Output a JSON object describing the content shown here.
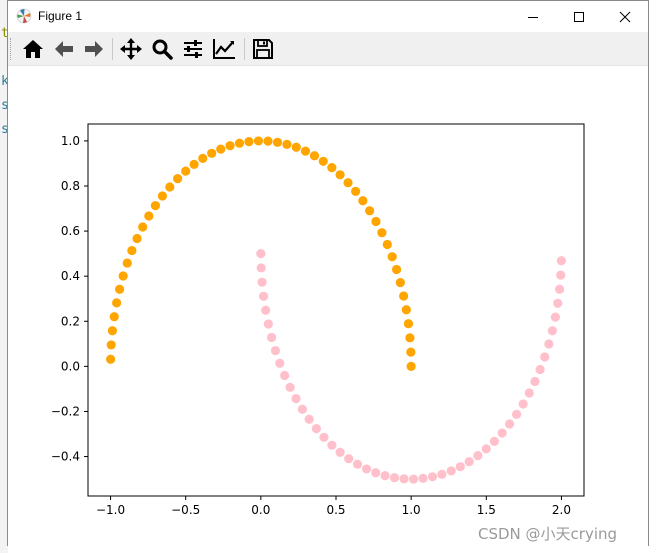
{
  "background": {
    "chars": [
      {
        "text": "t",
        "color": "#8a8a00",
        "top": 26
      },
      {
        "text": "k",
        "color": "#2e7d9a",
        "top": 74
      },
      {
        "text": "s",
        "color": "#2e7d9a",
        "top": 98
      },
      {
        "text": "s",
        "color": "#2e7d9a",
        "top": 122
      }
    ]
  },
  "window": {
    "title": "Figure 1",
    "controls": {
      "minimize": "minimize",
      "maximize": "maximize",
      "close": "close"
    }
  },
  "toolbar": {
    "buttons": [
      {
        "icon": "home-icon"
      },
      {
        "icon": "back-arrow-icon"
      },
      {
        "icon": "forward-arrow-icon"
      },
      {
        "icon": "pan-icon"
      },
      {
        "icon": "zoom-icon"
      },
      {
        "icon": "subplots-icon"
      },
      {
        "icon": "edit-axis-icon"
      },
      {
        "icon": "save-icon"
      }
    ]
  },
  "chart_data": {
    "type": "scatter",
    "title": "",
    "xlabel": "",
    "ylabel": "",
    "xlim": [
      -1.15,
      2.15
    ],
    "ylim": [
      -0.575,
      1.075
    ],
    "xticks": [
      -1.0,
      -0.5,
      0.0,
      0.5,
      1.0,
      1.5,
      2.0
    ],
    "xtick_labels": [
      "−1.0",
      "−0.5",
      "0.0",
      "0.5",
      "1.0",
      "1.5",
      "2.0"
    ],
    "yticks": [
      -0.4,
      -0.2,
      0.0,
      0.2,
      0.4,
      0.6,
      0.8,
      1.0
    ],
    "ytick_labels": [
      "−0.4",
      "−0.2",
      "0.0",
      "0.2",
      "0.4",
      "0.6",
      "0.8",
      "1.0"
    ],
    "grid": false,
    "legend": "none",
    "series": [
      {
        "color": "#ffa500",
        "points": [
          [
            1.0,
            0.0
          ],
          [
            0.998,
            0.0634
          ],
          [
            0.992,
            0.1266
          ],
          [
            0.9819,
            0.1893
          ],
          [
            0.9679,
            0.2511
          ],
          [
            0.9501,
            0.312
          ],
          [
            0.9284,
            0.3717
          ],
          [
            0.9029,
            0.4298
          ],
          [
            0.8739,
            0.4862
          ],
          [
            0.8413,
            0.5406
          ],
          [
            0.8053,
            0.5929
          ],
          [
            0.766,
            0.6428
          ],
          [
            0.7237,
            0.6901
          ],
          [
            0.6785,
            0.7346
          ],
          [
            0.6306,
            0.7761
          ],
          [
            0.5801,
            0.8146
          ],
          [
            0.5272,
            0.8497
          ],
          [
            0.4723,
            0.8815
          ],
          [
            0.4154,
            0.9096
          ],
          [
            0.3569,
            0.9341
          ],
          [
            0.2969,
            0.9549
          ],
          [
            0.2358,
            0.9718
          ],
          [
            0.1736,
            0.9848
          ],
          [
            0.1108,
            0.9938
          ],
          [
            0.0476,
            0.9989
          ],
          [
            -0.0159,
            0.9999
          ],
          [
            -0.0792,
            0.9969
          ],
          [
            -0.1423,
            0.9898
          ],
          [
            -0.2048,
            0.9788
          ],
          [
            -0.2665,
            0.9638
          ],
          [
            -0.3271,
            0.945
          ],
          [
            -0.3863,
            0.9224
          ],
          [
            -0.4441,
            0.896
          ],
          [
            -0.5,
            0.866
          ],
          [
            -0.5539,
            0.8326
          ],
          [
            -0.6056,
            0.7958
          ],
          [
            -0.6549,
            0.7557
          ],
          [
            -0.7015,
            0.7127
          ],
          [
            -0.7453,
            0.6668
          ],
          [
            -0.7861,
            0.6182
          ],
          [
            -0.8237,
            0.5671
          ],
          [
            -0.858,
            0.5137
          ],
          [
            -0.8888,
            0.4582
          ],
          [
            -0.9161,
            0.4009
          ],
          [
            -0.9397,
            0.342
          ],
          [
            -0.9595,
            0.2817
          ],
          [
            -0.9754,
            0.2203
          ],
          [
            -0.9874,
            0.158
          ],
          [
            -0.9955,
            0.0951
          ],
          [
            -0.9995,
            0.0317
          ]
        ]
      },
      {
        "color": "#ffc0cb",
        "points": [
          [
            0.0,
            0.5
          ],
          [
            0.002,
            0.4366
          ],
          [
            0.008,
            0.3734
          ],
          [
            0.0181,
            0.3107
          ],
          [
            0.0321,
            0.2489
          ],
          [
            0.0499,
            0.188
          ],
          [
            0.0716,
            0.1283
          ],
          [
            0.0971,
            0.0702
          ],
          [
            0.1261,
            0.0138
          ],
          [
            0.1587,
            -0.0406
          ],
          [
            0.1947,
            -0.0929
          ],
          [
            0.234,
            -0.1428
          ],
          [
            0.2763,
            -0.1901
          ],
          [
            0.3215,
            -0.2346
          ],
          [
            0.3694,
            -0.2761
          ],
          [
            0.4199,
            -0.3146
          ],
          [
            0.4728,
            -0.3497
          ],
          [
            0.5277,
            -0.3815
          ],
          [
            0.5846,
            -0.4096
          ],
          [
            0.6431,
            -0.4341
          ],
          [
            0.7031,
            -0.4549
          ],
          [
            0.7642,
            -0.4718
          ],
          [
            0.8264,
            -0.4848
          ],
          [
            0.8892,
            -0.4938
          ],
          [
            0.9524,
            -0.4989
          ],
          [
            1.0159,
            -0.4999
          ],
          [
            1.0792,
            -0.4969
          ],
          [
            1.1423,
            -0.4898
          ],
          [
            1.2048,
            -0.4788
          ],
          [
            1.2665,
            -0.4638
          ],
          [
            1.3271,
            -0.445
          ],
          [
            1.3863,
            -0.4224
          ],
          [
            1.4441,
            -0.396
          ],
          [
            1.5,
            -0.366
          ],
          [
            1.5539,
            -0.3326
          ],
          [
            1.6056,
            -0.2958
          ],
          [
            1.6549,
            -0.2557
          ],
          [
            1.7015,
            -0.2127
          ],
          [
            1.7453,
            -0.1668
          ],
          [
            1.7861,
            -0.1182
          ],
          [
            1.8237,
            -0.0671
          ],
          [
            1.858,
            -0.0137
          ],
          [
            1.8888,
            0.0418
          ],
          [
            1.9161,
            0.0991
          ],
          [
            1.9397,
            0.158
          ],
          [
            1.9595,
            0.2183
          ],
          [
            1.9754,
            0.2797
          ],
          [
            1.9874,
            0.342
          ],
          [
            1.9955,
            0.4049
          ],
          [
            1.9995,
            0.4683
          ]
        ]
      }
    ]
  },
  "watermark": "CSDN @小天crying"
}
